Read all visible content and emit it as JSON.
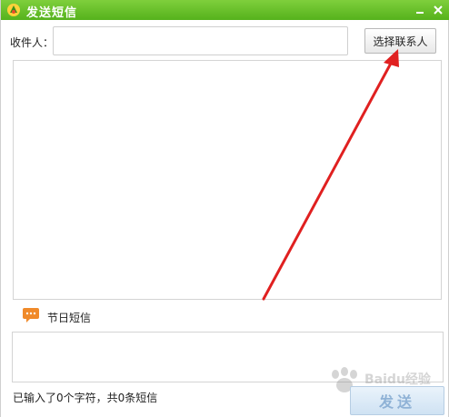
{
  "window": {
    "title": "发送短信",
    "minimize_glyph": "—",
    "close_glyph": "✕"
  },
  "recipient": {
    "label": "收件人：",
    "value": "",
    "select_button_label": "选择联系人"
  },
  "message": {
    "value": ""
  },
  "holiday": {
    "label": "节日短信",
    "icon": "speech-bubble-icon"
  },
  "status": {
    "text": "已输入了0个字符，共0条短信"
  },
  "send": {
    "label": "发送"
  },
  "colors": {
    "titlebar": "#66c12a",
    "annotation_arrow": "#e02020",
    "send_text": "#8fb2d6"
  },
  "watermark": {
    "text": "Baidu经验"
  }
}
